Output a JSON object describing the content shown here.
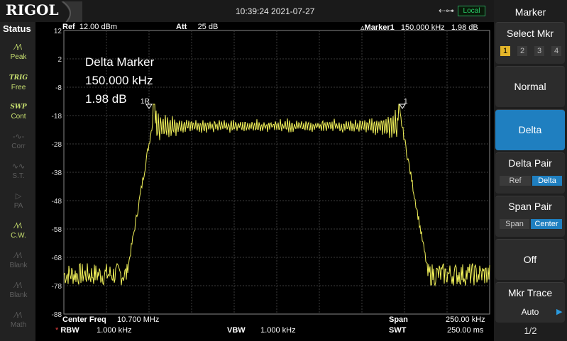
{
  "brand": "RIGOL",
  "datetime": "10:39:24 2021-07-27",
  "remote_status": "Local",
  "status_panel": {
    "title": "Status",
    "items": [
      {
        "icon": "peak-icon",
        "glyph": "∕\\∕\\",
        "label": "Peak",
        "state": "on"
      },
      {
        "icon": "trig-icon",
        "glyph": "TRIG",
        "label": "Free",
        "state": "on"
      },
      {
        "icon": "swp-icon",
        "glyph": "SWP",
        "label": "Cont",
        "state": "on"
      },
      {
        "icon": "corr-icon",
        "glyph": "-∿-",
        "label": "Corr",
        "state": "off"
      },
      {
        "icon": "st-icon",
        "glyph": "∿∿",
        "label": "S.T.",
        "state": "off"
      },
      {
        "icon": "pa-icon",
        "glyph": "▷",
        "label": "PA",
        "state": "off"
      },
      {
        "icon": "cw-icon",
        "glyph": "∕\\∕\\",
        "label": "C.W.",
        "state": "on"
      },
      {
        "icon": "blank-icon-1",
        "glyph": "∕\\∕\\",
        "label": "Blank",
        "state": "off"
      },
      {
        "icon": "blank-icon-2",
        "glyph": "∕\\∕\\",
        "label": "Blank",
        "state": "off"
      },
      {
        "icon": "math-icon",
        "glyph": "∕\\∕\\",
        "label": "Math",
        "state": "off"
      }
    ]
  },
  "header": {
    "ref_label": "Ref",
    "ref_value": "12.00 dBm",
    "att_label": "Att",
    "att_value": "25 dB",
    "marker_label": "Marker1",
    "marker_freq": "150.000 kHz",
    "marker_amp": "1.98 dB"
  },
  "delta_marker": {
    "title": "Delta Marker",
    "freq": "150.000 kHz",
    "amp": "1.98 dB"
  },
  "markers": {
    "ref_label": "1R",
    "delta_label": "1"
  },
  "y_axis": {
    "ticks": [
      "12",
      "2",
      "-8",
      "-18",
      "-28",
      "-38",
      "-48",
      "-58",
      "-68",
      "-78",
      "-88"
    ]
  },
  "footer": {
    "center_label": "Center Freq",
    "center_value": "10.700 MHz",
    "span_label": "Span",
    "span_value": "250.00 kHz",
    "rbw_label": "RBW",
    "rbw_value": "1.000 kHz",
    "vbw_label": "VBW",
    "vbw_value": "1.000 kHz",
    "swt_label": "SWT",
    "swt_value": "250.00 ms",
    "rbw_flag": "*"
  },
  "menu": {
    "title": "Marker",
    "select_mkr": {
      "label": "Select Mkr",
      "options": [
        "1",
        "2",
        "3",
        "4"
      ],
      "selected": "1"
    },
    "normal": "Normal",
    "delta": "Delta",
    "delta_pair": {
      "label": "Delta Pair",
      "options": [
        "Ref",
        "Delta"
      ],
      "selected": "Delta"
    },
    "span_pair": {
      "label": "Span Pair",
      "options": [
        "Span",
        "Center"
      ],
      "selected": "Center"
    },
    "off": "Off",
    "mkr_trace": {
      "label": "Mkr Trace",
      "value": "Auto"
    },
    "page": "1/2"
  },
  "colors": {
    "trace": "#f2f25a",
    "accent": "#1f7fc0",
    "selected_marker": "#e3b52a",
    "grid": "#3c3c3c"
  }
}
